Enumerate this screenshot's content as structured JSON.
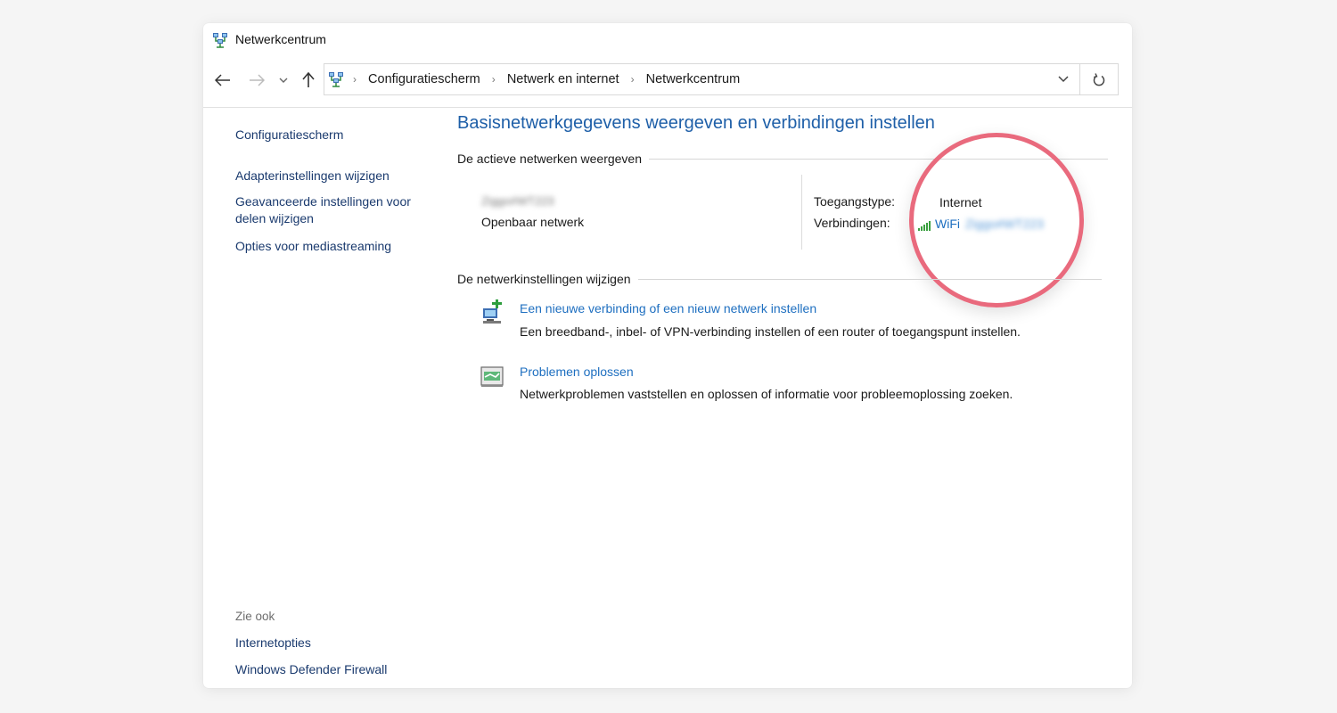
{
  "window": {
    "title": "Netwerkcentrum"
  },
  "nav": {
    "back_icon": "arrow-left-icon",
    "forward_icon": "arrow-right-icon",
    "recent_icon": "chevron-down-icon",
    "up_icon": "arrow-up-icon",
    "breadcrumb": [
      "Configuratiescherm",
      "Netwerk en internet",
      "Netwerkcentrum"
    ],
    "separator": "›",
    "dropdown_icon": "chevron-down-icon",
    "refresh_icon": "refresh-icon"
  },
  "sidebar": {
    "home_link": "Configuratiescherm",
    "links": [
      "Adapterinstellingen wijzigen",
      "Geavanceerde instellingen voor",
      "delen wijzigen",
      "Opties voor mediastreaming"
    ],
    "see_also_label": "Zie ook",
    "see_also_links": [
      "Internetopties",
      "Windows Defender Firewall"
    ]
  },
  "main": {
    "heading": "Basisnetwerkgegevens weergeven en verbindingen instellen",
    "active_networks_label": "De actieve netwerken weergeven",
    "network": {
      "name": "Ziggo#WT223",
      "type": "Openbaar netwerk",
      "access_type_label": "Toegangstype:",
      "access_type_value": "Internet",
      "connections_label": "Verbindingen:",
      "connection_link": "WiFi",
      "connection_ssid": "Ziggo#WT223"
    },
    "change_settings_label": "De netwerkinstellingen wijzigen",
    "tasks": [
      {
        "title": "Een nieuwe verbinding of een nieuw netwerk instellen",
        "description": "Een breedband-, inbel- of VPN-verbinding instellen of een router of toegangspunt instellen.",
        "icon": "new-connection-icon"
      },
      {
        "title": "Problemen oplossen",
        "description": "Netwerkproblemen vaststellen en oplossen of informatie voor probleemoplossing zoeken.",
        "icon": "troubleshoot-icon"
      }
    ]
  },
  "colors": {
    "heading": "#1e5fa8",
    "link": "#1e6fc0",
    "highlight": "#e96a7d",
    "signal": "#3aa040"
  }
}
